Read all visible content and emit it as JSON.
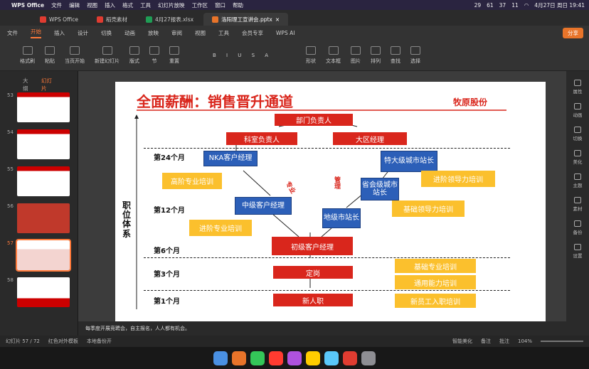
{
  "menubar": {
    "app": "WPS Office",
    "items": [
      "文件",
      "编辑",
      "视图",
      "插入",
      "格式",
      "工具",
      "幻灯片放映",
      "工作区",
      "窗口",
      "帮助"
    ],
    "badges": [
      "29",
      "61",
      "37",
      "11"
    ],
    "datetime": "4月27日 周日 19:41"
  },
  "tabs": [
    {
      "label": "WPS Office",
      "color": "#e03c31"
    },
    {
      "label": "稻壳素材",
      "color": "#e03c31"
    },
    {
      "label": "4月27报表.xlsx",
      "color": "#1f9d55"
    },
    {
      "label": "洛阳理工宣讲会.pptx",
      "color": "#e8742a"
    }
  ],
  "ribbon_tabs": [
    "文件",
    "开始",
    "插入",
    "设计",
    "切换",
    "动画",
    "放映",
    "审阅",
    "视图",
    "工具",
    "会员专享",
    "WPS AI"
  ],
  "ribbon_active": "开始",
  "share_label": "分享",
  "ribbon_groups": [
    "格式刷",
    "粘贴",
    "当页开始",
    "新建幻灯片",
    "版式",
    "节",
    "重置",
    "形状",
    "文本框",
    "图片",
    "排列",
    "查找",
    "选择"
  ],
  "sidebar": {
    "tabs": [
      "大纲",
      "幻灯片"
    ],
    "thumbs": [
      "53",
      "54",
      "55",
      "56",
      "57",
      "58"
    ],
    "selected": "57"
  },
  "right_panel": [
    "属性",
    "动画",
    "切换",
    "美化",
    "主题",
    "素材",
    "备份",
    "设置"
  ],
  "slide": {
    "title": "全面薪酬：销售晋升通道",
    "company": "牧原股份",
    "vertical_label": "职位体系",
    "periods": [
      "第24个月",
      "第12个月",
      "第6个月",
      "第3个月",
      "第1个月"
    ],
    "red_boxes": [
      "部门负责人",
      "科室负责人",
      "大区经理",
      "初级客户经理",
      "定岗",
      "新人职"
    ],
    "blue_boxes": [
      "NKA客户经理",
      "中级客户经理",
      "地级市站长",
      "省会级城市站长",
      "特大级城市站长"
    ],
    "yellow_boxes": [
      "高阶专业培训",
      "进阶专业培训",
      "进阶领导力培训",
      "基础领导力培训",
      "基础专业培训",
      "通用能力培训",
      "新员工入职培训"
    ],
    "track_labels": [
      "专业",
      "管理"
    ]
  },
  "notes": "每季度开展竞聘会，自主报名，人人都有机会。",
  "status": {
    "slide_count": "幻灯片 57 / 72",
    "template": "红色对外模板",
    "backup": "本地备份开",
    "beautify": "智能美化",
    "notes_btn": "备注",
    "comment_btn": "批注",
    "zoom": "104%"
  },
  "colors": {
    "accent": "#ff7a3a",
    "red": "#d9261c",
    "blue": "#2c5fb8",
    "yellow": "#fbc02d"
  }
}
